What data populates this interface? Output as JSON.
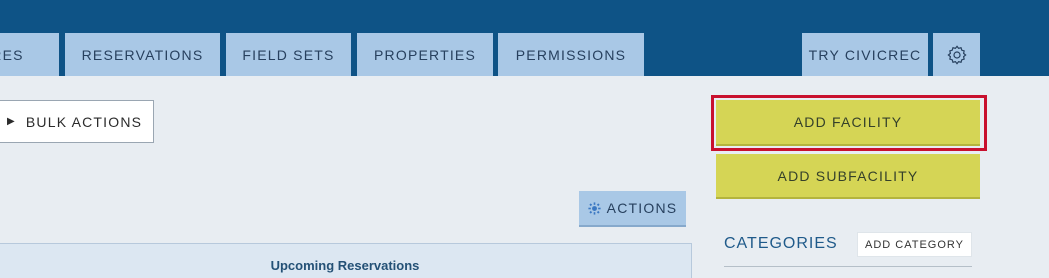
{
  "nav": {
    "tabs": [
      {
        "label": "URES"
      },
      {
        "label": "RESERVATIONS"
      },
      {
        "label": "FIELD SETS"
      },
      {
        "label": "PROPERTIES"
      },
      {
        "label": "PERMISSIONS"
      }
    ],
    "try_label": "TRY CIVICREC",
    "settings_icon": "gear-icon"
  },
  "toolbar": {
    "bulk_actions_label": "BULK ACTIONS",
    "bulk_actions_icon": "play-triangle-icon",
    "actions_label": "ACTIONS",
    "actions_icon": "gear-icon"
  },
  "side": {
    "add_facility_label": "ADD FACILITY",
    "add_subfacility_label": "ADD SUBFACILITY",
    "categories_title": "CATEGORIES",
    "add_category_label": "ADD CATEGORY"
  },
  "panel": {
    "upcoming_reservations_title": "Upcoming Reservations"
  },
  "colors": {
    "header_bg": "#0e5386",
    "tab_bg": "#a9c8e6",
    "tab_text": "#27405e",
    "yellow_button": "#d5d555",
    "highlight_outline": "#c8102e",
    "page_bg": "#e8edf2"
  }
}
